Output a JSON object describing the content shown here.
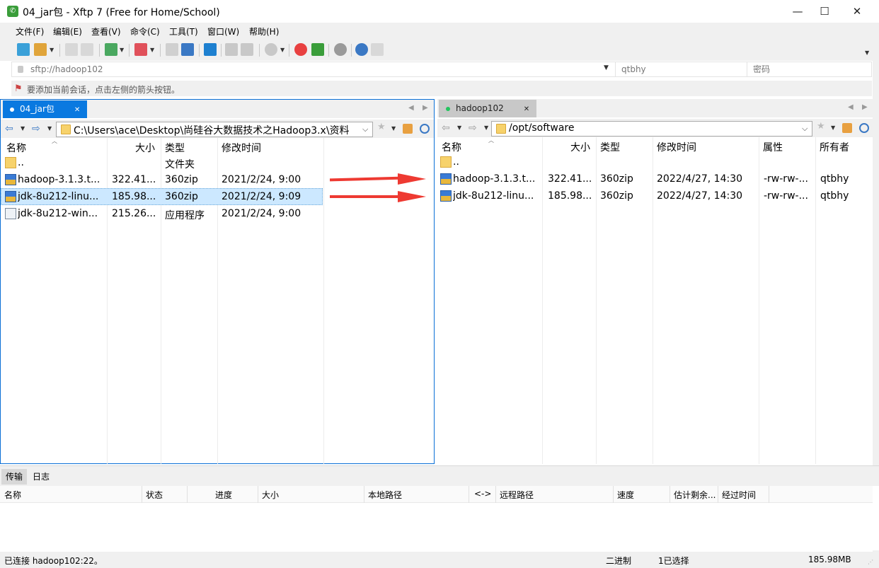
{
  "window": {
    "title": "04_jar包 - Xftp 7 (Free for Home/School)",
    "app_icon": "xftp-icon"
  },
  "window_controls": {
    "minimize": "—",
    "maximize": "☐",
    "close": "✕"
  },
  "menu": [
    "文件(F)",
    "编辑(E)",
    "查看(V)",
    "命令(C)",
    "工具(T)",
    "窗口(W)",
    "帮助(H)"
  ],
  "address": {
    "url": "sftp://hadoop102",
    "user": "qtbhy",
    "password_placeholder": "密码"
  },
  "hint": "要添加当前会话，点击左侧的箭头按钮。",
  "left_pane": {
    "tab": "04_jar包",
    "path": "C:\\Users\\ace\\Desktop\\尚硅谷大数据技术之Hadoop3.x\\资料",
    "columns": [
      "名称",
      "大小",
      "类型",
      "修改时间"
    ],
    "rows": [
      {
        "name": "..",
        "size": "",
        "type": "文件夹",
        "modified": "",
        "icon": "folder-icon"
      },
      {
        "name": "hadoop-3.1.3.t...",
        "size": "322.41...",
        "type": "360zip",
        "modified": "2021/2/24, 9:00",
        "icon": "archive-icon"
      },
      {
        "name": "jdk-8u212-linu...",
        "size": "185.98...",
        "type": "360zip",
        "modified": "2021/2/24, 9:09",
        "icon": "archive-icon",
        "selected": true
      },
      {
        "name": "jdk-8u212-win...",
        "size": "215.26...",
        "type": "应用程序",
        "modified": "2021/2/24, 9:00",
        "icon": "installer-icon"
      }
    ]
  },
  "right_pane": {
    "tab": "hadoop102",
    "path": "/opt/software",
    "columns": [
      "名称",
      "大小",
      "类型",
      "修改时间",
      "属性",
      "所有者"
    ],
    "rows": [
      {
        "name": "..",
        "size": "",
        "type": "",
        "modified": "",
        "attr": "",
        "owner": "",
        "icon": "folder-icon"
      },
      {
        "name": "hadoop-3.1.3.t...",
        "size": "322.41...",
        "type": "360zip",
        "modified": "2022/4/27, 14:30",
        "attr": "-rw-rw-...",
        "owner": "qtbhy",
        "icon": "archive-icon"
      },
      {
        "name": "jdk-8u212-linu...",
        "size": "185.98...",
        "type": "360zip",
        "modified": "2022/4/27, 14:30",
        "attr": "-rw-rw-...",
        "owner": "qtbhy",
        "icon": "archive-icon"
      }
    ]
  },
  "bottom": {
    "tabs": [
      "传输",
      "日志"
    ],
    "columns": [
      "名称",
      "状态",
      "进度",
      "大小",
      "本地路径",
      "<->",
      "远程路径",
      "速度",
      "估计剩余...",
      "经过时间"
    ]
  },
  "status": {
    "connection": "已连接 hadoop102:22。",
    "mode": "二进制",
    "selection": "1已选择",
    "size": "185.98MB"
  },
  "colors": {
    "accent": "#0a79e0",
    "arrow": "#ee3a32",
    "selected_row": "#cce8ff",
    "connected_dot": "#22c55e"
  }
}
